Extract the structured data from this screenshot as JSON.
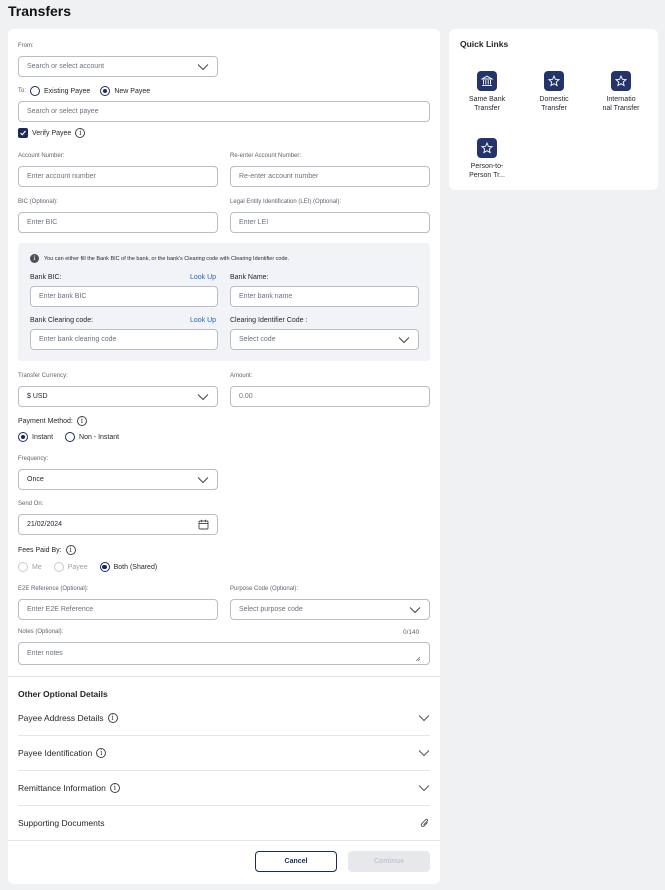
{
  "page": {
    "title": "Transfers"
  },
  "form": {
    "from_label": "From:",
    "from_placeholder": "Search or select account",
    "to_label": "To:",
    "existing_payee": "Existing Payee",
    "new_payee": "New Payee",
    "payee_placeholder": "Search or select payee",
    "verify_payee": "Verify Payee",
    "account_number_label": "Account Number:",
    "account_number_placeholder": "Enter account number",
    "reenter_label": "Re-enter Account Number:",
    "reenter_placeholder": "Re-enter account number",
    "bic_label": "BIC (Optional):",
    "bic_placeholder": "Enter BIC",
    "lei_label": "Legal Entity Identification (LEI) (Optional):",
    "lei_placeholder": "Enter LEI",
    "bank_info": "You can either fill the Bank BIC of the bank, or the bank's Clearing code with Clearing Identifier code.",
    "bank_bic_label": "Bank BIC:",
    "bank_bic_placeholder": "Enter bank BIC",
    "look_up": "Look Up",
    "bank_name_label": "Bank Name:",
    "bank_name_placeholder": "Enter bank name",
    "clearing_label": "Bank Clearing code:",
    "clearing_placeholder": "Enter bank clearing code",
    "clearing_id_label": "Clearing Identifier Code :",
    "clearing_id_placeholder": "Select code",
    "currency_label": "Transfer Currency:",
    "currency_value": "$ USD",
    "amount_label": "Amount:",
    "amount_placeholder": "0.00",
    "payment_method_label": "Payment Method:",
    "instant": "Instant",
    "non_instant": "Non - Instant",
    "frequency_label": "Frequency:",
    "frequency_value": "Once",
    "send_on_label": "Send On:",
    "send_on_value": "21/02/2024",
    "fees_label": "Fees Paid By:",
    "fee_me": "Me",
    "fee_payee": "Payee",
    "fee_both": "Both (Shared)",
    "e2e_label": "E2E Reference (Optional):",
    "e2e_placeholder": "Enter E2E Reference",
    "purpose_label": "Purpose Code (Optional):",
    "purpose_placeholder": "Select purpose code",
    "notes_label": "Notes (Optional):",
    "notes_counter": "0/140",
    "notes_placeholder": "Enter notes"
  },
  "optional": {
    "heading": "Other Optional Details",
    "payee_address": "Payee Address Details",
    "payee_identification": "Payee Identification",
    "remittance": "Remittance Information",
    "supporting_docs": "Supporting Documents"
  },
  "actions": {
    "cancel": "Cancel",
    "continue": "Continue"
  },
  "quick_links": {
    "title": "Quick Links",
    "same_bank_1": "Same Bank",
    "same_bank_2": "Transfer",
    "domestic_1": "Domestic",
    "domestic_2": "Transfer",
    "intl_1": "Internatio",
    "intl_2": "nal Transfer",
    "p2p_1": "Person-to-",
    "p2p_2": "Person Tr..."
  },
  "colors": {
    "primary": "#1b2a5c",
    "link": "#2566b8",
    "icon_bg": "#25336b"
  },
  "icons": [
    "chevron-down-icon",
    "info-icon",
    "calendar-icon",
    "paperclip-icon",
    "bank-icon",
    "star-icon",
    "checkbox-icon"
  ]
}
